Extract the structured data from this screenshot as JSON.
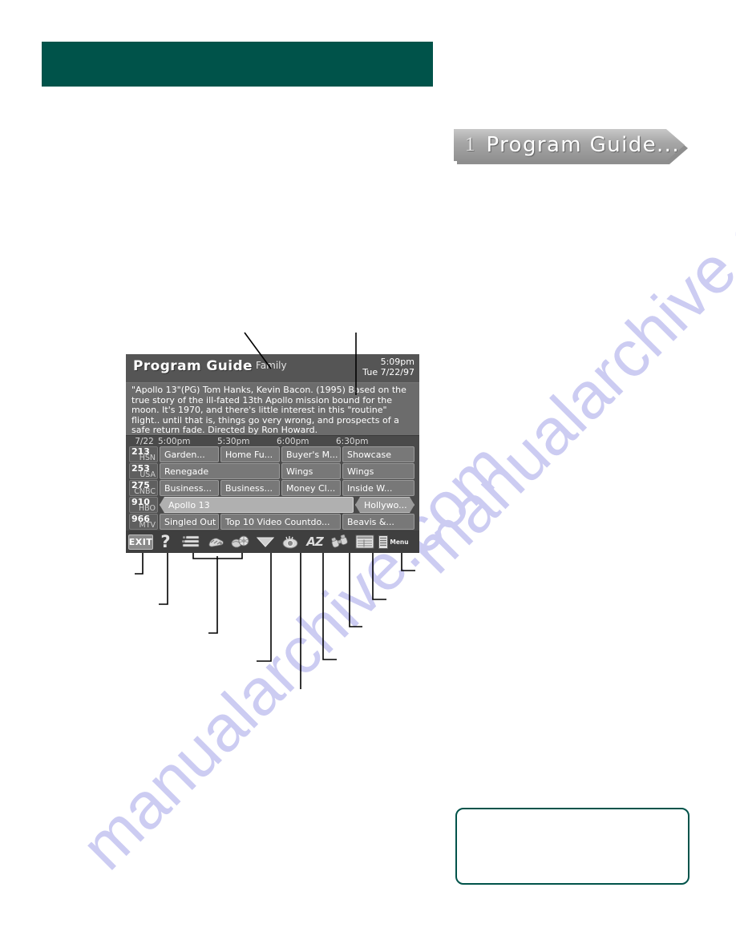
{
  "page": {
    "watermark": "manualarchive.com"
  },
  "header_bar": {
    "label": "",
    "color": "#00534a"
  },
  "section_banner": {
    "number": "1",
    "title": "Program Guide...",
    "shape": "chevron"
  },
  "tv_screen": {
    "title": "Program Guide",
    "category": "Family",
    "time": "5:09pm",
    "date": "Tue 7/22/97",
    "description": "\"Apollo 13\"(PG) Tom Hanks, Kevin Bacon. (1995) Based on the true story of the ill-fated 13th Apollo mission bound for the moon. It's 1970, and there's little interest in this \"routine\" flight.. until that is, things go very wrong, and prospects of a safe return fade. Directed by Ron Howard.",
    "grid": {
      "date_label": "7/22",
      "time_slots": [
        "5:00pm",
        "5:30pm",
        "6:00pm",
        "6:30pm"
      ],
      "rows": [
        {
          "channel_number": "213",
          "channel_call": "HSN",
          "programs": [
            {
              "title": "Garden...",
              "span": 1,
              "selected": false
            },
            {
              "title": "Home Fu...",
              "span": 1,
              "selected": false
            },
            {
              "title": "Buyer's M...",
              "span": 1,
              "selected": false
            },
            {
              "title": "Showcase",
              "span": 1,
              "selected": false
            }
          ]
        },
        {
          "channel_number": "253",
          "channel_call": "USA",
          "programs": [
            {
              "title": "Renegade",
              "span": 2,
              "selected": false
            },
            {
              "title": "Wings",
              "span": 1,
              "selected": false
            },
            {
              "title": "Wings",
              "span": 1,
              "selected": false
            }
          ]
        },
        {
          "channel_number": "275",
          "channel_call": "CNBC",
          "programs": [
            {
              "title": "Business...",
              "span": 1,
              "selected": false
            },
            {
              "title": "Business...",
              "span": 1,
              "selected": false
            },
            {
              "title": "Money Cl...",
              "span": 1,
              "selected": false
            },
            {
              "title": "Inside W...",
              "span": 1,
              "selected": false
            }
          ]
        },
        {
          "channel_number": "910",
          "channel_call": "HBO",
          "programs": [
            {
              "title": "Apollo 13",
              "span": 3,
              "selected": true
            },
            {
              "title": "Hollywo...",
              "span": 1,
              "selected": true
            }
          ]
        },
        {
          "channel_number": "966",
          "channel_call": "MTV",
          "programs": [
            {
              "title": "Singled Out",
              "span": 1,
              "selected": false
            },
            {
              "title": "Top 10 Video Countdo...",
              "span": 2,
              "selected": false
            },
            {
              "title": "Beavis &...",
              "span": 1,
              "selected": false
            }
          ]
        }
      ]
    },
    "toolbar": [
      {
        "name": "exit-button",
        "label": "EXIT",
        "icon": "exit-icon"
      },
      {
        "name": "help-button",
        "label": "?",
        "icon": "question-mark-icon"
      },
      {
        "name": "listings-button",
        "label": "",
        "icon": "listings-lines-icon"
      },
      {
        "name": "movies-button",
        "label": "",
        "icon": "film-shoe-icon"
      },
      {
        "name": "sports-button",
        "label": "",
        "icon": "sports-balls-icon"
      },
      {
        "name": "sort-down-button",
        "label": "",
        "icon": "triangle-down-icon"
      },
      {
        "name": "kids-button",
        "label": "",
        "icon": "eye-icon"
      },
      {
        "name": "alphabetical-button",
        "label": "AZ",
        "icon": "az-icon"
      },
      {
        "name": "search-button",
        "label": "",
        "icon": "binoculars-icon"
      },
      {
        "name": "grid-button",
        "label": "",
        "icon": "grid-table-icon"
      },
      {
        "name": "menu-button",
        "label": "Menu",
        "icon": "menu-icon"
      }
    ]
  },
  "note_box": {
    "text": ""
  }
}
